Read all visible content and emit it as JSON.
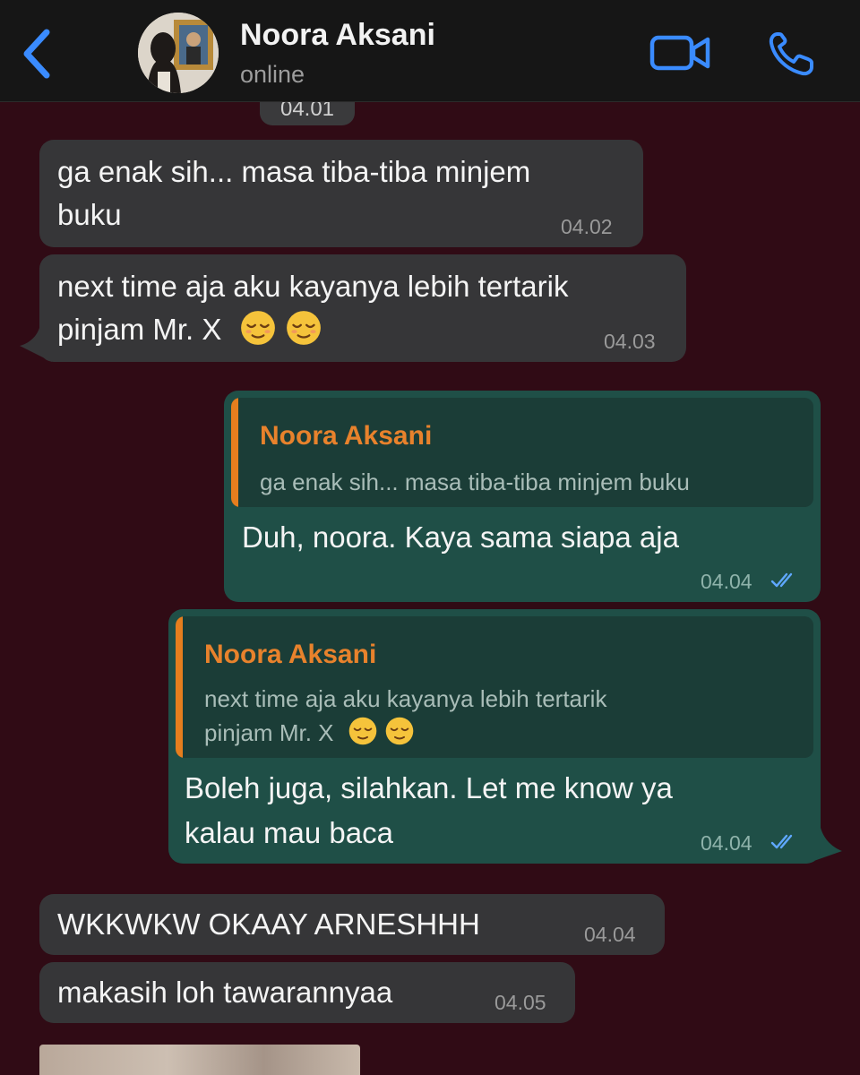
{
  "header": {
    "back_icon": "chevron-left-icon",
    "contact_name": "Noora Aksani",
    "status": "online",
    "video_icon": "video-camera-icon",
    "call_icon": "phone-icon",
    "accent": "#3a8bff"
  },
  "partial_time": "04.01",
  "messages": [
    {
      "direction": "incoming",
      "lines": [
        "ga enak sih... masa tiba-tiba minjem",
        "buku"
      ],
      "time": "04.02"
    },
    {
      "direction": "incoming",
      "lines": [
        "next time aja aku kayanya lebih tertarik",
        "pinjam Mr. X"
      ],
      "emojis": [
        "relieved-face-icon",
        "relieved-face-icon"
      ],
      "time": "04.03"
    },
    {
      "direction": "outgoing",
      "reply_to": {
        "name": "Noora Aksani",
        "lines": [
          "ga enak sih... masa tiba-tiba minjem buku"
        ]
      },
      "lines": [
        "Duh, noora. Kaya sama siapa aja"
      ],
      "time": "04.04",
      "status_icon": "double-check-read-icon"
    },
    {
      "direction": "outgoing",
      "reply_to": {
        "name": "Noora Aksani",
        "lines": [
          "next time aja aku kayanya lebih tertarik",
          "pinjam Mr. X"
        ]
      },
      "lines": [
        "Boleh juga, silahkan. Let me know ya",
        "kalau mau baca"
      ],
      "time": "04.04",
      "status_icon": "double-check-read-icon"
    },
    {
      "direction": "incoming",
      "lines": [
        "WKKWKW OKAAY ARNESHHH"
      ],
      "time": "04.04"
    },
    {
      "direction": "incoming",
      "lines": [
        "makasih loh tawarannyaa"
      ],
      "time": "04.05"
    }
  ],
  "colors": {
    "incoming_bubble": "#363638",
    "outgoing_bubble": "#1f4f47",
    "quote_accent": "#e67e1e",
    "read_tick": "#5fa8ff",
    "wallpaper": "#300b15"
  }
}
